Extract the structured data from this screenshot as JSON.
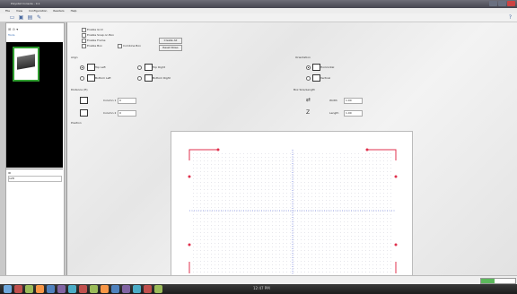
{
  "window": {
    "title": "Polystat Console - 0.1"
  },
  "menu": [
    "File",
    "View",
    "Configuration",
    "Readers",
    "Help"
  ],
  "toolbar": {
    "icons": [
      "open-icon",
      "save-icon",
      "print-icon",
      "wand-icon"
    ]
  },
  "left_panel": {
    "tools_label": "Tools",
    "lower_label": "ID",
    "lower_value": "128"
  },
  "options": {
    "enable_grid": "Enable Grid",
    "enable_snap": "Enable Snap on Box",
    "enable_frame": "Enable Frame",
    "enable_box": "Enable Box",
    "combine_box": "Combine Box",
    "btn_create": "Create All",
    "btn_reset": "Reset Rows"
  },
  "sections": {
    "align": "Align",
    "top_left": "Top Left",
    "top_right": "Top Right",
    "bottom_left": "Bottom Left",
    "bottom_right": "Bottom Right",
    "orientation": "Orientation",
    "horizontal": "Horizontal",
    "vertical": "Vertical",
    "distance": "Distance (ft)",
    "from_1_label": "Column 1",
    "from_1_value": "0",
    "from_2_label": "Column 2",
    "from_2_value": "0",
    "box_size": "Box Size/Length",
    "width_label": "Width",
    "width_value": "1.00",
    "length_label": "Length",
    "length_value": "1.00",
    "position": "Position"
  },
  "statusbar": {
    "progress": 0.4
  },
  "taskbar": {
    "clock": "12:47 PM"
  },
  "colors": {
    "accent": "#3b6fb6",
    "selection": "#2f9e2f",
    "corner": "#e0304c",
    "axis": "#3a4fd0"
  }
}
